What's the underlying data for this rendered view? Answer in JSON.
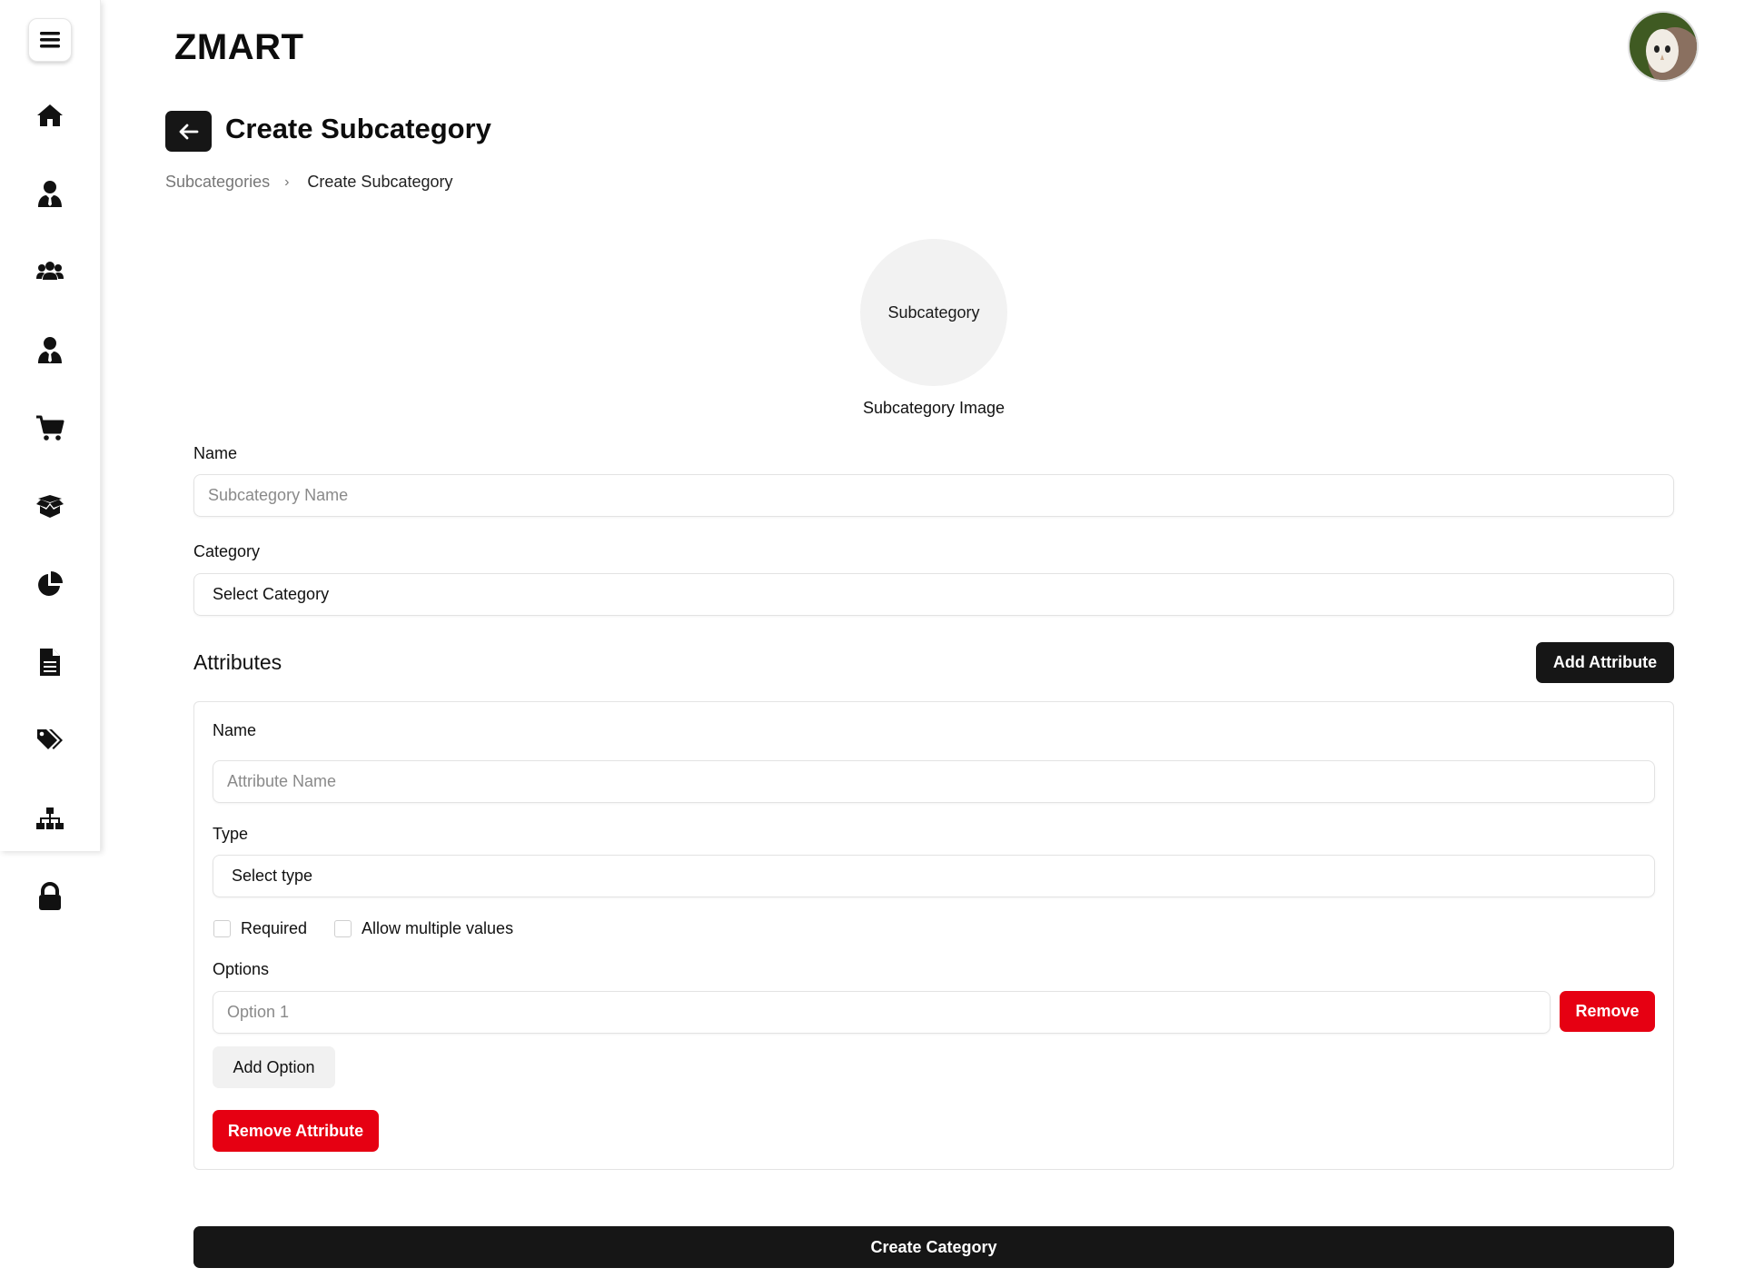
{
  "app": {
    "brand": "ZMART"
  },
  "page": {
    "title": "Create Subcategory",
    "breadcrumb": {
      "parent": "Subcategories",
      "separator": "›",
      "current": "Create Subcategory"
    }
  },
  "sidebar": {
    "items": [
      {
        "name": "home-icon"
      },
      {
        "name": "user-tie-icon"
      },
      {
        "name": "users-icon"
      },
      {
        "name": "user-tie-icon-2"
      },
      {
        "name": "cart-icon"
      },
      {
        "name": "box-open-icon"
      },
      {
        "name": "pie-chart-icon"
      },
      {
        "name": "document-icon"
      },
      {
        "name": "tags-icon"
      },
      {
        "name": "sitemap-icon"
      },
      {
        "name": "lock-icon"
      }
    ]
  },
  "image_upload": {
    "circle_text": "Subcategory",
    "label": "Subcategory Image"
  },
  "form": {
    "name": {
      "label": "Name",
      "placeholder": "Subcategory Name"
    },
    "category": {
      "label": "Category",
      "selected": "Select Category"
    }
  },
  "attributes": {
    "title": "Attributes",
    "add_button": "Add Attribute",
    "items": [
      {
        "name_label": "Name",
        "name_placeholder": "Attribute Name",
        "type_label": "Type",
        "type_selected": "Select type",
        "required_label": "Required",
        "multiple_label": "Allow multiple values",
        "options_label": "Options",
        "options": [
          {
            "placeholder": "Option 1",
            "remove_label": "Remove"
          }
        ],
        "add_option_label": "Add Option",
        "remove_attribute_label": "Remove Attribute"
      }
    ]
  },
  "submit": {
    "label": "Create Category"
  },
  "colors": {
    "dark": "#161616",
    "danger": "#e60012",
    "light_btn": "#f1f1f1"
  }
}
